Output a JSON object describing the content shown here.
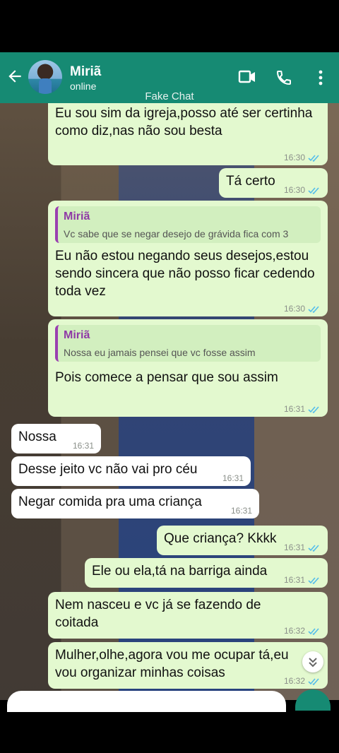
{
  "header": {
    "name": "Miriã",
    "status": "online",
    "overlay_label": "Fake Chat"
  },
  "colors": {
    "header": "#168a73",
    "outgoing": "#e3f9cf",
    "incoming": "#ffffff",
    "quote_name": "#8f3aa6",
    "read_ticks": "#53bdeb"
  },
  "messages": [
    {
      "type": "out",
      "text": "Eu sou sim da igreja,posso até ser certinha como diz,nas não sou besta",
      "time": "16:30"
    },
    {
      "type": "out",
      "text": "Tá certo",
      "time": "16:30"
    },
    {
      "type": "out",
      "quote_name": "Miriã",
      "quote_text": "Vc sabe que se negar desejo de grávida fica com 3",
      "text": "Eu não estou negando seus desejos,estou sendo sincera que não posso ficar cedendo toda vez",
      "time": "16:30"
    },
    {
      "type": "out",
      "quote_name": "Miriã",
      "quote_text": "Nossa eu jamais pensei que vc fosse assim",
      "text": "Pois comece a pensar que sou assim",
      "time": "16:31"
    },
    {
      "type": "in",
      "text": "Nossa",
      "time": "16:31"
    },
    {
      "type": "in",
      "text": "Desse jeito vc não vai pro céu",
      "time": "16:31"
    },
    {
      "type": "in",
      "text": "Negar comida pra uma criança",
      "time": "16:31"
    },
    {
      "type": "out",
      "text": "Que criança? Kkkk",
      "time": "16:31"
    },
    {
      "type": "out",
      "text": "Ele ou ela,tá na barriga ainda",
      "time": "16:31"
    },
    {
      "type": "out",
      "text": "Nem nasceu e vc já se fazendo de coitada",
      "time": "16:32"
    },
    {
      "type": "out",
      "text": "Mulher,olhe,agora vou me ocupar tá,eu vou organizar minhas coisas",
      "time": "16:32"
    }
  ]
}
